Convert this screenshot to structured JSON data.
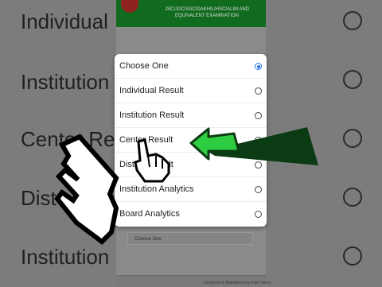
{
  "background": {
    "list_items": [
      {
        "label": "Individual"
      },
      {
        "label": "Institution"
      },
      {
        "label": "Center Result"
      },
      {
        "label": "Dist"
      },
      {
        "label": "Institution"
      }
    ],
    "header_text": "JSC/JDC/SSC/DAKHIL/HSC/ALIM AND EQUIVALENT EXAMINATION",
    "select_value": "Choose One",
    "footer_text": "Designed & Maintained by Inter Vision"
  },
  "dialog": {
    "options": [
      {
        "label": "Choose One",
        "selected": true
      },
      {
        "label": "Individual Result",
        "selected": false
      },
      {
        "label": "Institution Result",
        "selected": false
      },
      {
        "label": "Center Result",
        "selected": false
      },
      {
        "label": "District Result",
        "selected": false
      },
      {
        "label": "Institution Analytics",
        "selected": false
      },
      {
        "label": "Board Analytics",
        "selected": false
      }
    ]
  },
  "colors": {
    "accent_radio": "#1e73e8",
    "header_green": "#106b1e",
    "arrow_green": "#2ecc40"
  },
  "icons": [
    "hand-pointer-cursor-icon",
    "green-arrow-icon",
    "board-logo-icon"
  ]
}
